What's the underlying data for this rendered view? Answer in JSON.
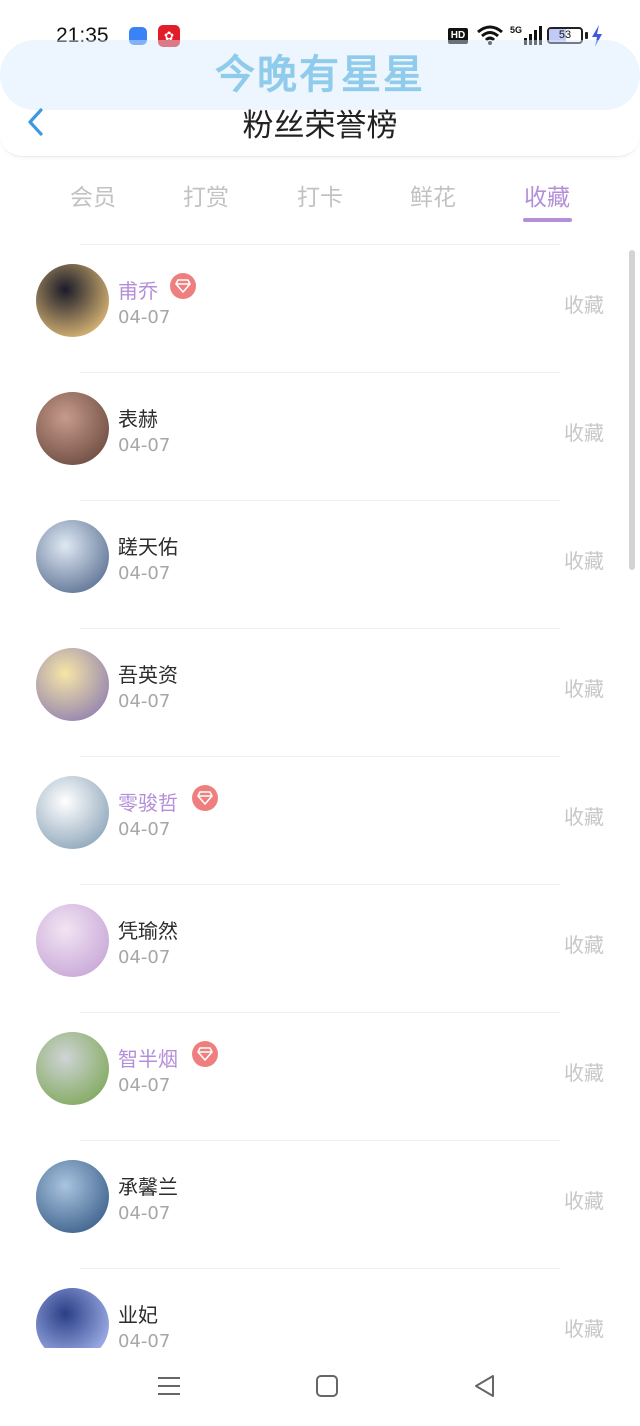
{
  "status": {
    "time": "21:35",
    "hd_label": "HD",
    "network": "5G",
    "battery": "53",
    "battery_level": 0.53
  },
  "header": {
    "watermark": "今晚有星星",
    "title": "粉丝荣誉榜",
    "back_icon": "chevron-left-icon"
  },
  "tabs": [
    {
      "label": "会员",
      "active": false
    },
    {
      "label": "打赏",
      "active": false
    },
    {
      "label": "打卡",
      "active": false
    },
    {
      "label": "鲜花",
      "active": false
    },
    {
      "label": "收藏",
      "active": true
    }
  ],
  "accent_color": "#b48fd9",
  "badge_color": "#ef7f7f",
  "fans": [
    {
      "name": "甫乔",
      "date": "04-07",
      "action": "收藏",
      "vip": true,
      "avatar_colors": [
        "#1b1b28",
        "#e6c07a"
      ]
    },
    {
      "name": "表赫",
      "date": "04-07",
      "action": "收藏",
      "vip": false,
      "avatar_colors": [
        "#c79b8c",
        "#6b4b3f"
      ]
    },
    {
      "name": "蹉天佑",
      "date": "04-07",
      "action": "收藏",
      "vip": false,
      "avatar_colors": [
        "#dfe9f3",
        "#5a6f92"
      ]
    },
    {
      "name": "吾英资",
      "date": "04-07",
      "action": "收藏",
      "vip": false,
      "avatar_colors": [
        "#f6e6a6",
        "#8f7fb0"
      ]
    },
    {
      "name": "零骏哲",
      "date": "04-07",
      "action": "收藏",
      "vip": true,
      "avatar_colors": [
        "#ffffff",
        "#8aa3b8"
      ]
    },
    {
      "name": "凭瑜然",
      "date": "04-07",
      "action": "收藏",
      "vip": false,
      "avatar_colors": [
        "#f1e4f3",
        "#c7a6d6"
      ]
    },
    {
      "name": "智半烟",
      "date": "04-07",
      "action": "收藏",
      "vip": true,
      "avatar_colors": [
        "#cfd4d6",
        "#7fa85a"
      ]
    },
    {
      "name": "承馨兰",
      "date": "04-07",
      "action": "收藏",
      "vip": false,
      "avatar_colors": [
        "#a9c4df",
        "#3b5f8a"
      ]
    },
    {
      "name": "业妃",
      "date": "04-07",
      "action": "收藏",
      "vip": false,
      "avatar_colors": [
        "#2a3f86",
        "#aab8f0"
      ]
    }
  ],
  "nav": {
    "menu_icon": "menu-icon",
    "home_icon": "home-square-icon",
    "back_icon": "back-triangle-icon"
  }
}
